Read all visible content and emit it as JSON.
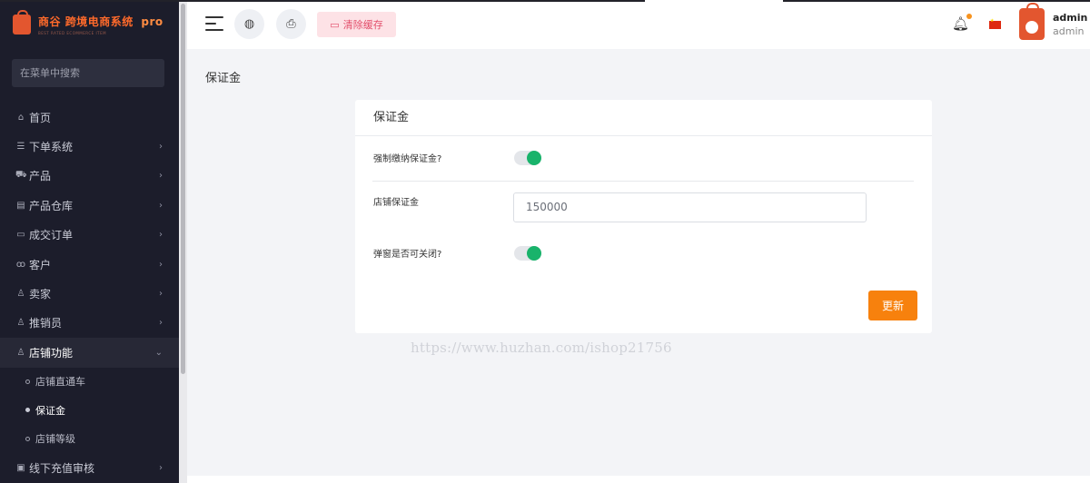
{
  "logo": {
    "name": "商谷",
    "subtitle": "跨境电商系统",
    "badge": "pro",
    "tagline": "BEST RATED ECOMMERCE ITEM",
    "icon": "shopping-bag-icon",
    "brand_color": "#e3562f"
  },
  "sidebar": {
    "search_placeholder": "在菜单中搜索",
    "items": [
      {
        "label": "首页",
        "icon": "home-icon",
        "arrow": ""
      },
      {
        "label": "下单系统",
        "icon": "list-icon",
        "arrow": "›"
      },
      {
        "label": "产品",
        "icon": "cart-icon",
        "arrow": "›"
      },
      {
        "label": "产品仓库",
        "icon": "warehouse-icon",
        "arrow": "›"
      },
      {
        "label": "成交订单",
        "icon": "order-icon",
        "arrow": "›"
      },
      {
        "label": "客户",
        "icon": "users-icon",
        "arrow": "›"
      },
      {
        "label": "卖家",
        "icon": "user-icon",
        "arrow": "›"
      },
      {
        "label": "推销员",
        "icon": "user-icon",
        "arrow": "›"
      },
      {
        "label": "店铺功能",
        "icon": "user-icon",
        "arrow": "⌄",
        "open": true
      },
      {
        "label": "线下充值审核",
        "icon": "card-icon",
        "arrow": "›"
      }
    ],
    "subitems": [
      {
        "label": "店铺直通车",
        "active": false
      },
      {
        "label": "保证金",
        "active": true
      },
      {
        "label": "店铺等级",
        "active": false
      }
    ]
  },
  "header": {
    "menu_icon": "hamburger-icon",
    "globe_icon": "globe-icon",
    "print_icon": "printer-icon",
    "clear_cache_label": "清除缓存",
    "notification_icon": "bell-icon",
    "language_icon": "china-flag-icon",
    "user": {
      "name": "admin",
      "role": "admin"
    }
  },
  "main": {
    "page_title": "保证金",
    "card_title": "保证金",
    "fields": {
      "force_deposit": {
        "label": "强制缴纳保证金?",
        "enabled": true
      },
      "store_deposit": {
        "label": "店铺保证金",
        "value": "150000"
      },
      "popup_closable": {
        "label": "弹窗是否可关闭?",
        "enabled": true
      }
    },
    "submit_label": "更新"
  },
  "watermark": "https://www.huzhan.com/ishop21756",
  "colors": {
    "accent": "#f7810d",
    "toggle_on": "#19b36b",
    "sidebar_bg": "#1c1d2b",
    "clear_button_bg": "#fde2e6"
  }
}
